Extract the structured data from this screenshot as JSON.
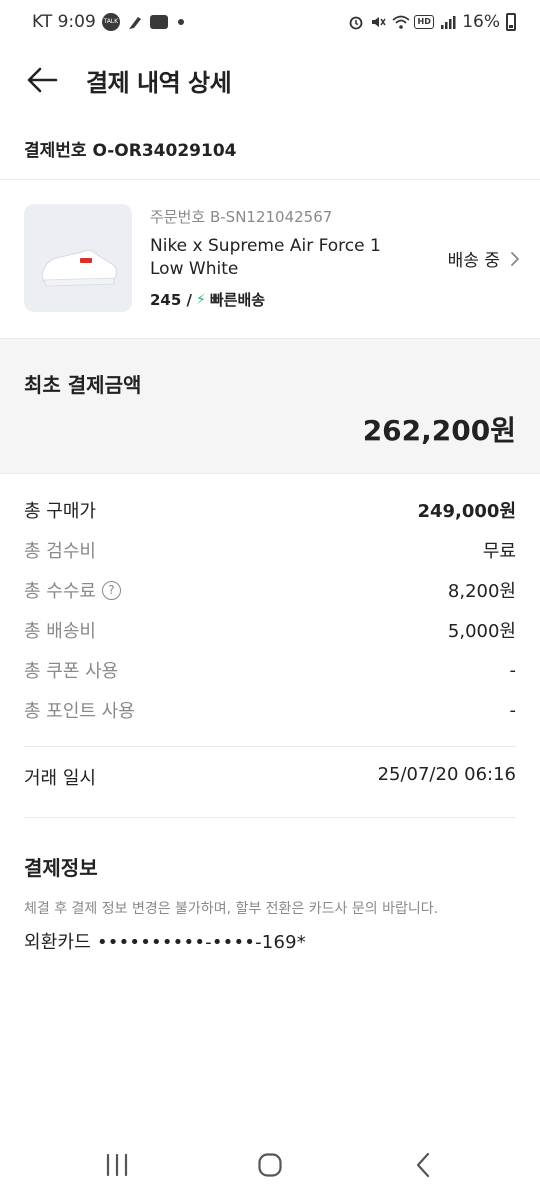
{
  "status_bar": {
    "carrier_time": "KT 9:09",
    "battery": "16%"
  },
  "header": {
    "title": "결제 내역 상세"
  },
  "order": {
    "label": "결제번호 O-OR34029104"
  },
  "product": {
    "sub_order": "주문번호 B-SN121042567",
    "name": "Nike x Supreme Air Force 1 Low White",
    "size": "245 /",
    "delivery_type": "빠른배송",
    "status": "배송 중"
  },
  "total": {
    "label": "최초 결제금액",
    "amount": "262,200원"
  },
  "rows": [
    {
      "label": "총 구매가",
      "value": "249,000원"
    },
    {
      "label": "총 검수비",
      "value": "무료"
    },
    {
      "label": "총 수수료",
      "value": "8,200원"
    },
    {
      "label": "총 배송비",
      "value": "5,000원"
    },
    {
      "label": "총 쿠폰 사용",
      "value": "-"
    },
    {
      "label": "총 포인트 사용",
      "value": "-"
    }
  ],
  "trade": {
    "label": "거래 일시",
    "value": "25/07/20 06:16"
  },
  "payment": {
    "title": "결제정보",
    "note": "체결 후 결제 정보 변경은 불가하며, 할부 전환은 카드사 문의 바랍니다.",
    "card": "외환카드 ••••••••••-••••-169*"
  },
  "icons": {
    "back": "arrow-left-icon",
    "chevron": "chevron-right-icon",
    "help": "question-circle-icon",
    "nav_recent": "recent-apps-icon",
    "nav_home": "home-icon",
    "nav_back": "nav-back-icon"
  }
}
